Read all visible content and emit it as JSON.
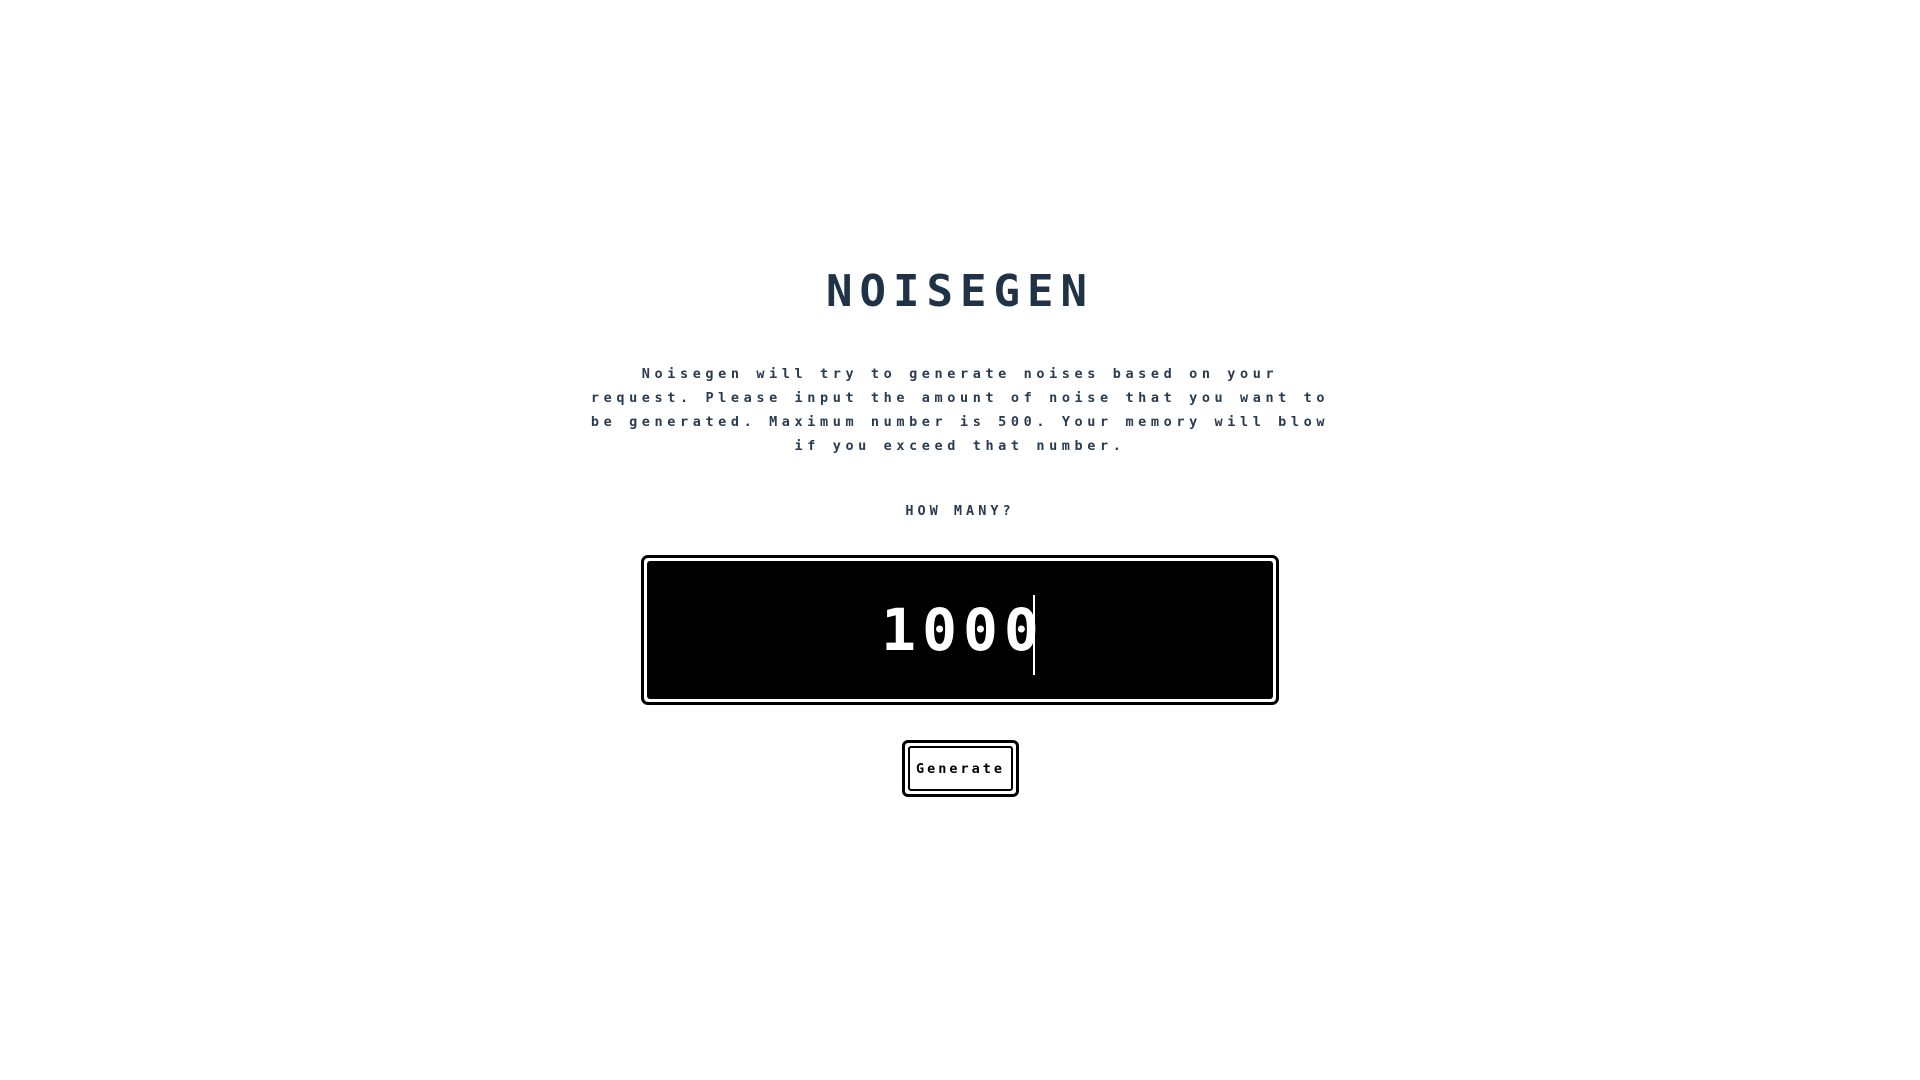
{
  "app": {
    "title": "NOISEGEN",
    "description": "Noisegen will try to generate noises based on your request. Please input the amount of noise that you want to be generated. Maximum number is 500. Your memory will blow if you exceed that number."
  },
  "form": {
    "prompt_label": "HOW MANY?",
    "count_value": "1000",
    "generate_label": "Generate"
  },
  "colors": {
    "text": "#24344a",
    "input_bg": "#000000",
    "input_text": "#ffffff",
    "button_border": "#000000"
  }
}
